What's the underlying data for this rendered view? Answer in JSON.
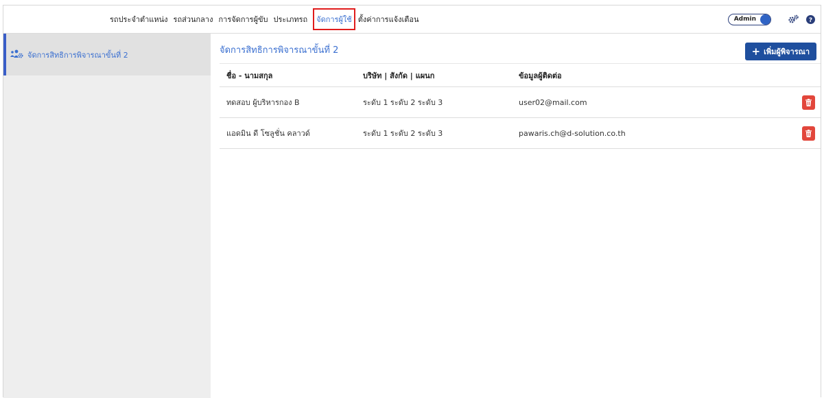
{
  "nav": {
    "items": [
      {
        "label": "รถประจำตำแหน่ง",
        "active": false
      },
      {
        "label": "รถส่วนกลาง",
        "active": false
      },
      {
        "label": "การจัดการผู้ขับ",
        "active": false
      },
      {
        "label": "ประเภทรถ",
        "active": false
      },
      {
        "label": "จัดการผู้ใช้",
        "active": true
      },
      {
        "label": "ตั้งค่าการแจ้งเตือน",
        "active": false
      }
    ],
    "admin_label": "Admin",
    "settings_icon": "gears-icon",
    "help_icon": "help-icon"
  },
  "sidebar": {
    "items": [
      {
        "label": "จัดการสิทธิการพิจารณาขั้นที่ 2",
        "icon": "users-cog-icon",
        "active": true
      }
    ]
  },
  "main": {
    "title": "จัดการสิทธิการพิจารณาขั้นที่ 2",
    "add_button_label": "เพิ่มผู้พิจารณา",
    "table": {
      "headers": [
        "ชื่อ - นามสกุล",
        "บริษัท | สังกัด | แผนก",
        "ข้อมูลผู้ติดต่อ"
      ],
      "rows": [
        {
          "name": "ทดสอบ ผู้บริหารกอง B",
          "org": "ระดับ 1 ระดับ 2 ระดับ 3",
          "contact": "user02@mail.com"
        },
        {
          "name": "แอดมิน ดี โซลูชั่น คลาวด์",
          "org": "ระดับ 1 ระดับ 2 ระดับ 3",
          "contact": "pawaris.ch@d-solution.co.th"
        }
      ]
    }
  },
  "colors": {
    "accent": "#3a6fd0",
    "button_primary": "#1f4f9e",
    "danger": "#e2463b",
    "highlight_box": "#e01b1b"
  }
}
